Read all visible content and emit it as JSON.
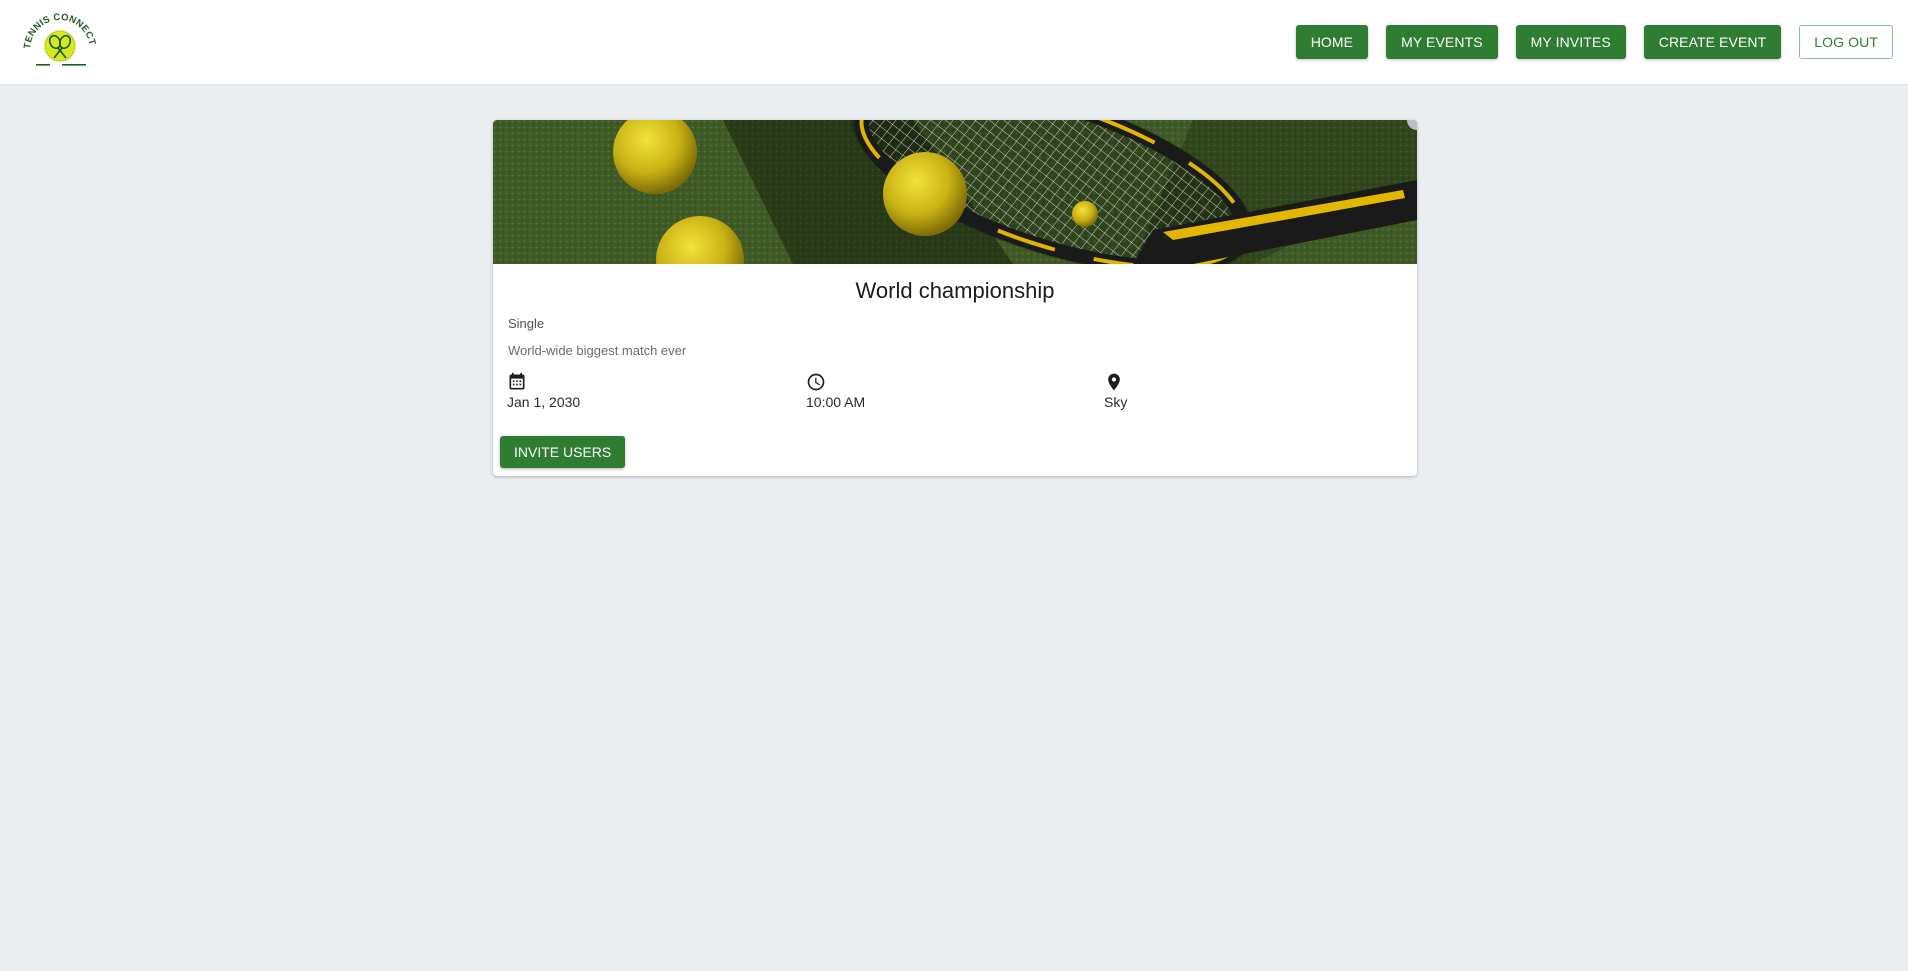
{
  "header": {
    "logo_text": "TENNIS CONNECT 360",
    "nav": {
      "home": "HOME",
      "my_events": "MY EVENTS",
      "my_invites": "MY INVITES",
      "create_event": "CREATE EVENT",
      "log_out": "LOG OUT"
    }
  },
  "event": {
    "title": "World championship",
    "type": "Single",
    "description": "World-wide biggest match ever",
    "date": "Jan 1, 2030",
    "time": "10:00 AM",
    "location": "Sky",
    "invite_label": "INVITE USERS"
  },
  "colors": {
    "primary": "#2e7d32",
    "background": "#eaeef1",
    "card": "#ffffff"
  },
  "icons": [
    "calendar-icon",
    "clock-icon",
    "location-pin-icon"
  ]
}
